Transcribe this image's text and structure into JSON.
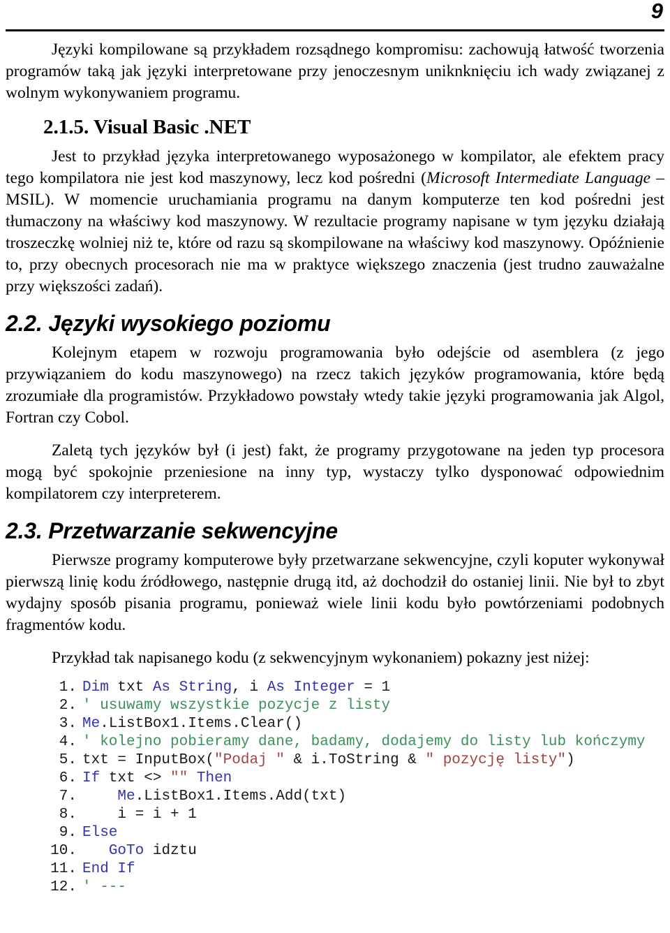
{
  "header": {
    "page_number": "9"
  },
  "body": {
    "paragraph_1": "Języki kompilowane są przykładem rozsądnego kompromisu: zachowują łatwość tworzenia programów taką jak języki interpretowane przy jenoczesnym uniknknięciu ich wady związanej z wolnym wykonywaniem programu.",
    "heading_215": "2.1.5. Visual Basic .NET",
    "paragraph_2_part1": "Jest to przykład języka interpretowanego wyposażonego w kompilator, ale efektem pracy tego kompilatora nie jest kod maszynowy, lecz kod pośredni (",
    "paragraph_2_italic1": "Microsoft Intermediate Language",
    "paragraph_2_part2": " – MSIL). W momencie uruchamiania programu na danym komputerze ten kod pośredni jest tłumaczony na właściwy kod maszynowy. W rezultacie programy napisane w tym języku działają troszeczkę wolniej niż te, które od razu są skompilowane na właściwy kod maszynowy. Opóźnienie to, przy obecnych procesorach nie ma w praktyce większego znaczenia (jest trudno zauważalne przy większości zadań).",
    "heading_22": "2.2. Języki wysokiego poziomu",
    "paragraph_3": "Kolejnym etapem w rozwoju programowania było odejście od asemblera (z jego przywiązaniem do kodu maszynowego) na rzecz takich języków programowania, które będą zrozumiałe dla programistów. Przykładowo powstały wtedy takie języki programowania jak Algol, Fortran czy Cobol.",
    "paragraph_4": "Zaletą tych języków był (i jest) fakt, że programy przygotowane na jeden typ procesora mogą być spokojnie przeniesione na inny typ, wystaczy tylko dysponować odpowiednim kompilatorem czy interpreterem.",
    "heading_23": "2.3. Przetwarzanie sekwencyjne",
    "paragraph_5": "Pierwsze programy komputerowe były przetwarzane sekwencyjne, czyli koputer wykonywał pierwszą linię kodu źródłowego, następnie drugą itd, aż dochodził do ostaniej linii. Nie był to zbyt wydajny sposób pisania programu, ponieważ wiele linii kodu było powtórzeniami podobnych fragmentów kodu.",
    "paragraph_6": "Przykład tak napisanego kodu (z sekwencyjnym wykonaniem) pokazny jest niżej:"
  },
  "code": {
    "language": "Visual Basic .NET",
    "colors": {
      "keyword": "#3333aa",
      "comment": "#3f8f5f",
      "string": "#a04545",
      "plain": "#1a1a1a"
    },
    "lines": [
      {
        "number": "1",
        "text": "Dim txt As String, i As Integer = 1",
        "tokens": [
          {
            "t": "Dim",
            "c": "kw"
          },
          {
            "t": " txt ",
            "c": "plain"
          },
          {
            "t": "As",
            "c": "kw"
          },
          {
            "t": " ",
            "c": "plain"
          },
          {
            "t": "String",
            "c": "kw"
          },
          {
            "t": ", i ",
            "c": "plain"
          },
          {
            "t": "As",
            "c": "kw"
          },
          {
            "t": " ",
            "c": "plain"
          },
          {
            "t": "Integer",
            "c": "kw"
          },
          {
            "t": " = 1",
            "c": "plain"
          }
        ]
      },
      {
        "number": "2",
        "text": "' usuwamy wszystkie pozycje z listy",
        "tokens": [
          {
            "t": "' usuwamy wszystkie pozycje z listy",
            "c": "cmt"
          }
        ]
      },
      {
        "number": "3",
        "text": "Me.ListBox1.Items.Clear()",
        "tokens": [
          {
            "t": "Me",
            "c": "kw"
          },
          {
            "t": ".ListBox1.Items.Clear()",
            "c": "plain"
          }
        ]
      },
      {
        "number": "4",
        "text": "' kolejno pobieramy dane, badamy, dodajemy do listy lub kończymy",
        "tokens": [
          {
            "t": "' kolejno pobieramy dane, badamy, dodajemy do listy lub kończymy",
            "c": "cmt"
          }
        ]
      },
      {
        "number": "5",
        "text": "txt = InputBox(\"Podaj \" & i.ToString & \" pozycję listy\")",
        "tokens": [
          {
            "t": "txt = InputBox(",
            "c": "plain"
          },
          {
            "t": "\"Podaj \"",
            "c": "str"
          },
          {
            "t": " & i.ToString & ",
            "c": "plain"
          },
          {
            "t": "\" pozycję listy\"",
            "c": "str"
          },
          {
            "t": ")",
            "c": "plain"
          }
        ]
      },
      {
        "number": "6",
        "text": "If txt <> \"\" Then",
        "tokens": [
          {
            "t": "If",
            "c": "kw"
          },
          {
            "t": " txt <> ",
            "c": "plain"
          },
          {
            "t": "\"\"",
            "c": "str"
          },
          {
            "t": " ",
            "c": "plain"
          },
          {
            "t": "Then",
            "c": "kw"
          }
        ]
      },
      {
        "number": "7",
        "text": "    Me.ListBox1.Items.Add(txt)",
        "tokens": [
          {
            "t": "    ",
            "c": "plain"
          },
          {
            "t": "Me",
            "c": "kw"
          },
          {
            "t": ".ListBox1.Items.Add(txt)",
            "c": "plain"
          }
        ]
      },
      {
        "number": "8",
        "text": "    i = i + 1",
        "tokens": [
          {
            "t": "    i = i + 1",
            "c": "plain"
          }
        ]
      },
      {
        "number": "9",
        "text": "Else",
        "tokens": [
          {
            "t": "Else",
            "c": "kw"
          }
        ]
      },
      {
        "number": "10",
        "text": "    GoTo idztu",
        "tokens": [
          {
            "t": "   ",
            "c": "plain"
          },
          {
            "t": "GoTo",
            "c": "kw"
          },
          {
            "t": " idztu",
            "c": "plain"
          }
        ]
      },
      {
        "number": "11",
        "text": "End If",
        "tokens": [
          {
            "t": "End If",
            "c": "kw"
          }
        ]
      },
      {
        "number": "12",
        "text": "' ---",
        "tokens": [
          {
            "t": "' ---",
            "c": "cmt"
          }
        ]
      }
    ]
  }
}
